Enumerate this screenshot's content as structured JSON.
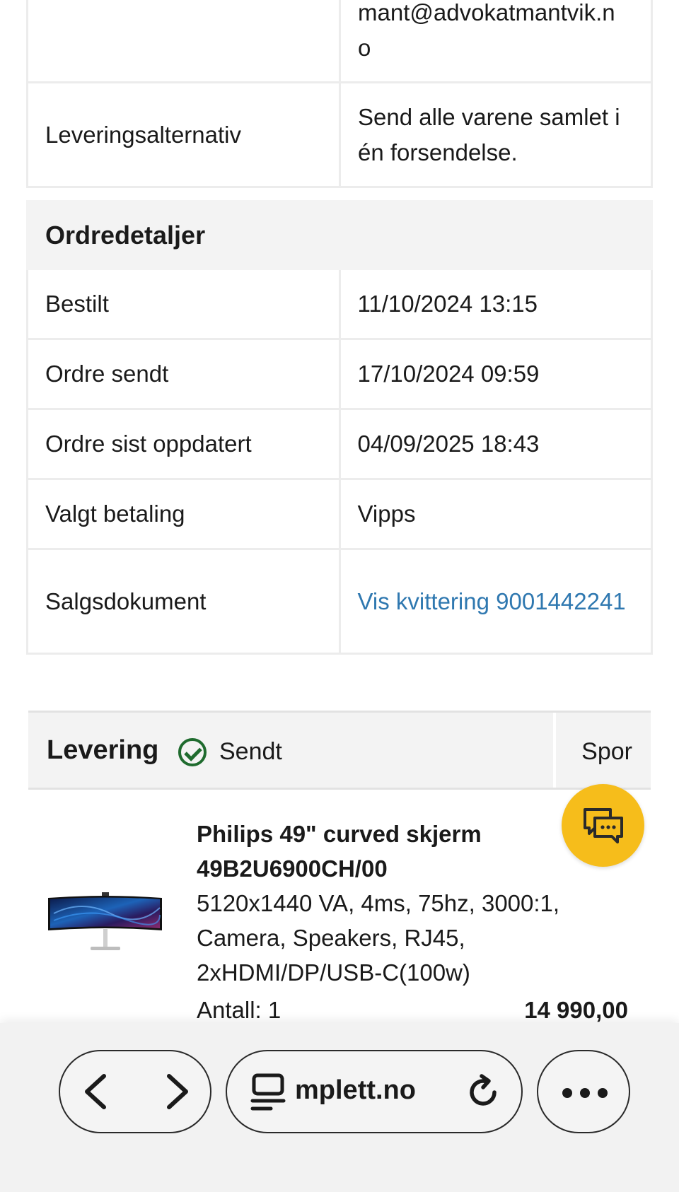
{
  "contact_table": {
    "email_value_tail": "mant@advokatmantvik.n o",
    "delivery_option_label": "Leveringsalternativ",
    "delivery_option_value": "Send alle varene samlet i én forsendelse."
  },
  "order_details": {
    "heading": "Ordredetaljer",
    "rows": [
      {
        "label": "Bestilt",
        "value": "11/10/2024 13:15"
      },
      {
        "label": "Ordre sendt",
        "value": "17/10/2024 09:59"
      },
      {
        "label": "Ordre sist oppdatert",
        "value": "04/09/2025 18:43"
      },
      {
        "label": "Valgt betaling",
        "value": "Vipps"
      },
      {
        "label": "Salgsdokument",
        "value": "Vis kvittering 9001442241"
      }
    ]
  },
  "delivery": {
    "label": "Levering",
    "status": "Sendt",
    "track_label": "Spor"
  },
  "product": {
    "title": "Philips 49\" curved skjerm 49B2U6900CH/00",
    "description": "5120x1440 VA, 4ms, 75hz, 3000:1, Camera, Speakers, RJ45, 2xHDMI/DP/USB-C(100w)",
    "quantity": "Antall: 1",
    "price": "14 990,00"
  },
  "browser": {
    "url_display": "mplett.no"
  },
  "colors": {
    "accent_yellow": "#f6bd1b",
    "link_blue": "#2f78b0",
    "status_green": "#1f6b2e"
  }
}
